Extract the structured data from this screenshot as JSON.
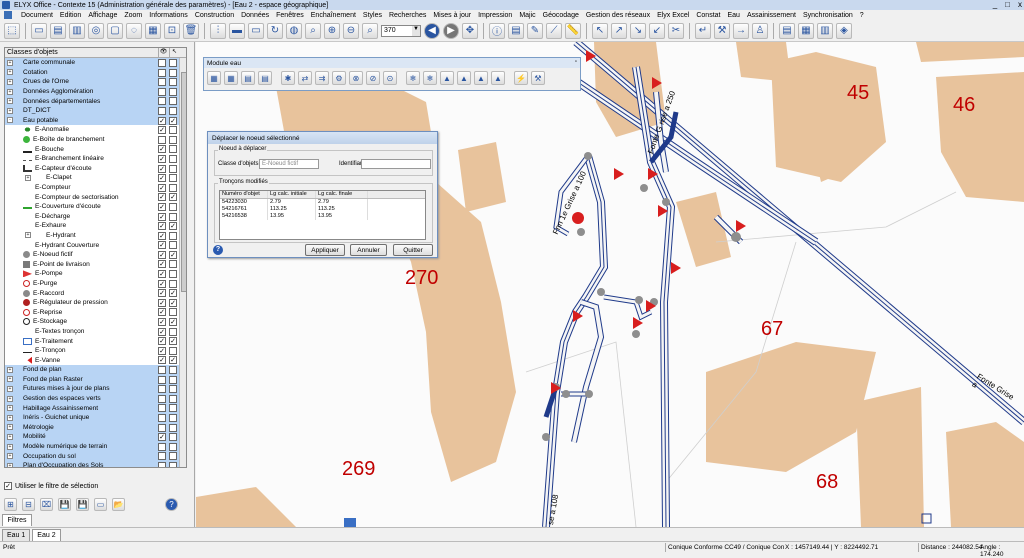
{
  "window": {
    "title": "ELYX Office - Contexte 15 (Administration générale des paramètres) - [Eau 2 - espace géographique]",
    "controls": [
      "_",
      "□",
      "x"
    ]
  },
  "menu": [
    "Document",
    "Edition",
    "Affichage",
    "Zoom",
    "Informations",
    "Construction",
    "Données",
    "Fenêtres",
    "Enchaînement",
    "Styles",
    "Recherches",
    "Mises à jour",
    "Impression",
    "Majic",
    "Géocodage",
    "Gestion des réseaux",
    "Elyx Excel",
    "Constat",
    "Eau",
    "Assainissement",
    "Synchronisation",
    "?"
  ],
  "toolbar": {
    "zoom_value": "370"
  },
  "layers": {
    "header": "Classes d'objets",
    "header_icons": [
      "eye-icon",
      "pointer-icon"
    ],
    "rows": [
      {
        "label": "Carte communale",
        "group": true,
        "exp": "+",
        "c1": "",
        "c2": ""
      },
      {
        "label": "Cotation",
        "group": true,
        "exp": "+",
        "c1": "",
        "c2": ""
      },
      {
        "label": "Crues de l'Orne",
        "group": true,
        "exp": "+",
        "c1": "",
        "c2": ""
      },
      {
        "label": "Données Agglomération",
        "group": true,
        "exp": "+",
        "c1": "",
        "c2": ""
      },
      {
        "label": "Données départementales",
        "group": true,
        "exp": "+",
        "c1": "",
        "c2": ""
      },
      {
        "label": "DT_DICT",
        "group": true,
        "exp": "+",
        "c1": "",
        "c2": ""
      },
      {
        "label": "Eau potable",
        "group": true,
        "exp": "-",
        "c1": "✓",
        "c2": "✓"
      },
      {
        "label": "E-Anomalie",
        "icon": "anomaly-icon",
        "c1": "✓",
        "c2": ""
      },
      {
        "label": "E-Boîte de branchement",
        "icon": "green-dot-icon",
        "c1": "",
        "c2": ""
      },
      {
        "label": "E-Bouche",
        "icon": "bouche-icon",
        "c1": "✓",
        "c2": ""
      },
      {
        "label": "E-Branchement linéaire",
        "icon": "dashed-line-icon",
        "c1": "✓",
        "c2": ""
      },
      {
        "label": "E-Capteur d'écoute",
        "icon": "sensor-icon",
        "c1": "✓",
        "c2": ""
      },
      {
        "label": "E-Clapet",
        "icon": "",
        "exp": "+",
        "c1": "✓",
        "c2": ""
      },
      {
        "label": "E-Compteur",
        "icon": "",
        "c1": "✓",
        "c2": ""
      },
      {
        "label": "E-Compteur de sectorisation",
        "icon": "",
        "c1": "✓",
        "c2": "✓"
      },
      {
        "label": "E-Couverture d'écoute",
        "icon": "green-line-icon",
        "c1": "✓",
        "c2": ""
      },
      {
        "label": "E-Décharge",
        "icon": "",
        "c1": "✓",
        "c2": ""
      },
      {
        "label": "E-Exhaure",
        "icon": "",
        "c1": "✓",
        "c2": "✓"
      },
      {
        "label": "E-Hydrant",
        "icon": "",
        "exp": "+",
        "c1": "✓",
        "c2": ""
      },
      {
        "label": "E-Hydrant Couverture",
        "icon": "",
        "c1": "✓",
        "c2": ""
      },
      {
        "label": "E-Noeud fictif",
        "icon": "grey-dot-icon",
        "c1": "✓",
        "c2": "✓"
      },
      {
        "label": "E-Point de livraison",
        "icon": "delivery-icon",
        "c1": "✓",
        "c2": ""
      },
      {
        "label": "E-Pompe",
        "icon": "pump-icon",
        "c1": "✓",
        "c2": ""
      },
      {
        "label": "E-Purge",
        "icon": "purge-icon",
        "c1": "✓",
        "c2": ""
      },
      {
        "label": "E-Raccord",
        "icon": "grey-dot-icon",
        "c1": "✓",
        "c2": "✓"
      },
      {
        "label": "E-Régulateur de pression",
        "icon": "regulator-icon",
        "c1": "✓",
        "c2": "✓"
      },
      {
        "label": "E-Reprise",
        "icon": "reprise-icon",
        "c1": "✓",
        "c2": ""
      },
      {
        "label": "E-Stockage",
        "icon": "circle-icon",
        "c1": "✓",
        "c2": "✓"
      },
      {
        "label": "E-Textes tronçon",
        "icon": "",
        "c1": "✓",
        "c2": ""
      },
      {
        "label": "E-Traitement",
        "icon": "treatment-icon",
        "c1": "✓",
        "c2": "✓"
      },
      {
        "label": "E-Tronçon",
        "icon": "line-icon",
        "c1": "✓",
        "c2": ""
      },
      {
        "label": "E-Vanne",
        "icon": "valve-icon",
        "c1": "✓",
        "c2": "✓"
      },
      {
        "label": "Fond de plan",
        "group": true,
        "exp": "+",
        "c1": "",
        "c2": ""
      },
      {
        "label": "Fond de plan Raster",
        "group": true,
        "exp": "+",
        "c1": "",
        "c2": ""
      },
      {
        "label": "Futures mises à jour de plans",
        "group": true,
        "exp": "+",
        "c1": "",
        "c2": ""
      },
      {
        "label": "Gestion des espaces verts",
        "group": true,
        "exp": "+",
        "c1": "",
        "c2": ""
      },
      {
        "label": "Habillage Assainissement",
        "group": true,
        "exp": "+",
        "c1": "",
        "c2": ""
      },
      {
        "label": "Inéris - Guichet unique",
        "group": true,
        "exp": "+",
        "c1": "",
        "c2": ""
      },
      {
        "label": "Métrologie",
        "group": true,
        "exp": "+",
        "c1": "",
        "c2": ""
      },
      {
        "label": "Mobilité",
        "group": true,
        "exp": "+",
        "c1": "✓",
        "c2": ""
      },
      {
        "label": "Modèle numérique de terrain",
        "group": true,
        "exp": "+",
        "c1": "",
        "c2": ""
      },
      {
        "label": "Occupation du sol",
        "group": true,
        "exp": "+",
        "c1": "",
        "c2": ""
      },
      {
        "label": "Plan d'Occupation des Sols",
        "group": true,
        "exp": "+",
        "c1": "",
        "c2": ""
      }
    ]
  },
  "filter": {
    "label": "Utiliser le filtre de sélection",
    "checked": "✓"
  },
  "left_tab": "Filtres",
  "module": {
    "title": "Module eau"
  },
  "dialog": {
    "title": "Déplacer le noeud sélectionné",
    "group1": "Noeud à déplacer",
    "class_label": "Classe d'objets",
    "class_value": "E-Noeud fictif",
    "id_label": "Identifiant",
    "id_value": "",
    "group2": "Tronçons modifiés",
    "columns": [
      "Numéro d'objet",
      "Lg calc. initiale",
      "Lg calc. finale"
    ],
    "rows": [
      [
        "54223030",
        "2.79",
        "2.79"
      ],
      [
        "54216761",
        "113.25",
        "113.25"
      ],
      [
        "54216538",
        "13.95",
        "13.95"
      ]
    ],
    "btn_apply": "Appliquer",
    "btn_cancel": "Annuler",
    "btn_quit": "Quitter",
    "help": "?"
  },
  "map": {
    "parcels": [
      "45",
      "46",
      "270",
      "67",
      "269",
      "68"
    ],
    "streets": [
      "Fonte G rise a 250",
      "Fnn 1e Grise a 100",
      "Fonte Grise a",
      "se a 108"
    ]
  },
  "tabs": [
    "Eau 1",
    "Eau 2"
  ],
  "status": {
    "ready": "Prêt",
    "projection": "Conique Conforme CC49 / Conique Con",
    "coords": "X : 1457149.44 | Y : 8224492.71",
    "distance": "Distance : 244082.54",
    "angle": "Angle : 174.240"
  },
  "colors": {
    "parcel": "#e8c39c",
    "pipe": "#1f3a8a",
    "plot_number": "#c00000",
    "layer_group": "#b8d4f4"
  }
}
